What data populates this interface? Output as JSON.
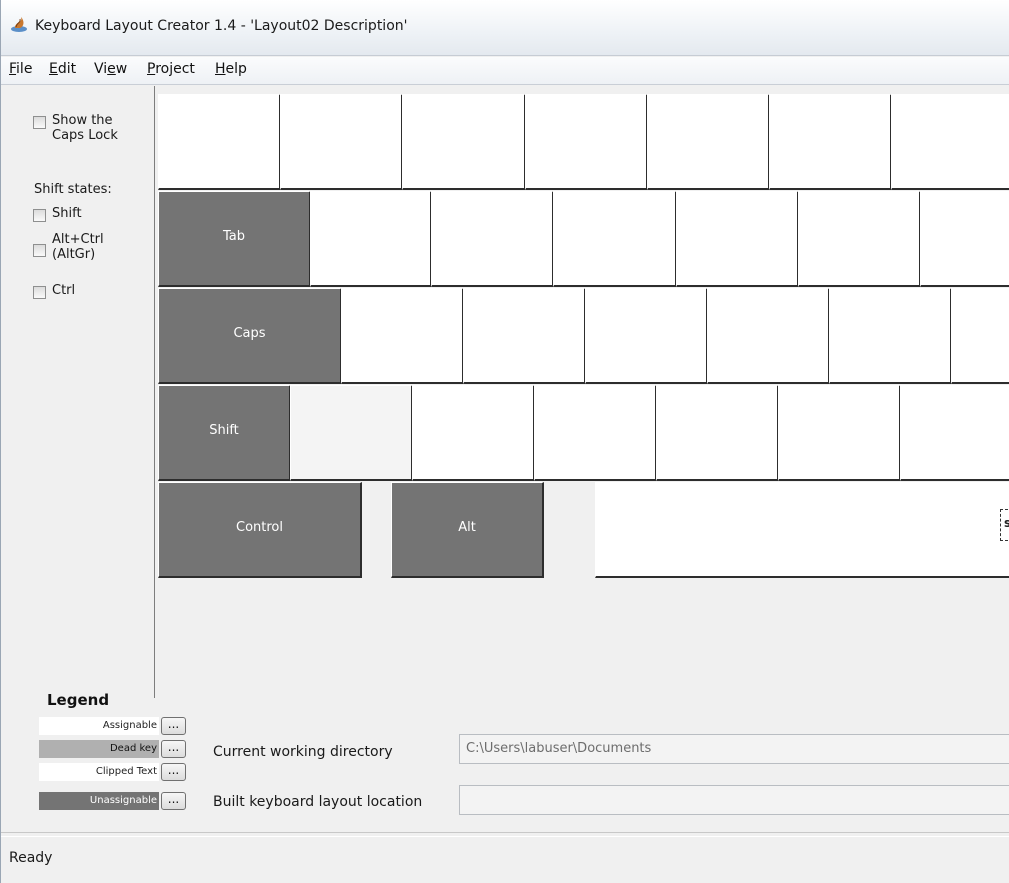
{
  "window": {
    "title": "Keyboard Layout Creator 1.4 - 'Layout02 Description'",
    "icon": "keyboard-layout-creator-icon"
  },
  "menu": [
    {
      "label": "File",
      "mnemonic": "F",
      "rest": "ile"
    },
    {
      "label": "Edit",
      "mnemonic": "E",
      "rest": "dit"
    },
    {
      "label": "View",
      "pre": "Vi",
      "mnemonic": "e",
      "rest": "w"
    },
    {
      "label": "Project",
      "mnemonic": "P",
      "rest": "roject"
    },
    {
      "label": "Help",
      "mnemonic": "H",
      "rest": "elp"
    }
  ],
  "left_panel": {
    "show_caps_lock": "Show the\nCaps Lock",
    "shift_states_label": "Shift states:",
    "shift_states": [
      {
        "label": "Shift"
      },
      {
        "label": "Alt+Ctrl\n(AltGr)"
      },
      {
        "label": "Ctrl"
      }
    ]
  },
  "keyboard": {
    "tab_label": "Tab",
    "caps_label": "Caps",
    "shift_label": "Shift",
    "control_label": "Control",
    "alt_label": "Alt",
    "space_clipped_label": "s"
  },
  "legend": {
    "title": "Legend",
    "items": [
      {
        "label": "Assignable",
        "color": "#ffffff",
        "text_color": "#222222"
      },
      {
        "label": "Dead key",
        "color": "#b0b0b0",
        "text_color": "#111111"
      },
      {
        "label": "Clipped Text",
        "color": "#ffffff",
        "text_color": "#222222"
      },
      {
        "label": "Unassignable",
        "color": "#747474",
        "text_color": "#ffffff"
      }
    ],
    "button_label": "..."
  },
  "fields": {
    "current_working_directory_label": "Current working directory",
    "current_working_directory_value": "C:\\Users\\labuser\\Documents",
    "built_layout_location_label": "Built keyboard layout location",
    "built_layout_location_value": ""
  },
  "status": {
    "text": "Ready"
  }
}
